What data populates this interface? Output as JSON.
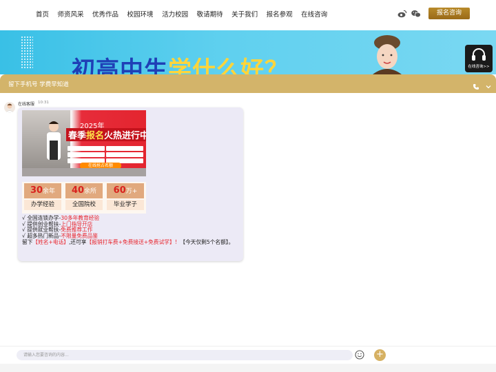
{
  "nav": {
    "items": [
      {
        "label": "首页"
      },
      {
        "label": "师资风采"
      },
      {
        "label": "优秀作品"
      },
      {
        "label": "校园环境"
      },
      {
        "label": "活力校园"
      },
      {
        "label": "敬请期待"
      },
      {
        "label": "关于我们"
      },
      {
        "label": "报名参观"
      },
      {
        "label": "在线咨询"
      }
    ],
    "social_icons": [
      "weibo-icon",
      "wechat-icon"
    ],
    "apply_button": "报名咨询"
  },
  "banner": {
    "headline_part1": "初高中生",
    "headline_part2": "学什么好？",
    "colors": {
      "blue": "#1f3fb6",
      "yellow": "#ffd53a",
      "bg": "#39c0e6"
    }
  },
  "online_widget": {
    "label": "在线咨询>>"
  },
  "chat": {
    "header_text": "留下手机号 学费早知道",
    "header_color": "#d3b46a",
    "agent_name": "在线客服",
    "time": "10:31",
    "promo": {
      "title_line1": "2025年",
      "title_line2_a": "春季",
      "title_line2_b": "报名",
      "title_line2_c": "火热进行中",
      "cta": "在线抢占名额"
    },
    "stats": [
      {
        "number": "30",
        "unit": "余年",
        "label": "办学经验"
      },
      {
        "number": "40",
        "unit": "余所",
        "label": "全国院校"
      },
      {
        "number": "60",
        "unit": "万+",
        "label": "毕业学子"
      }
    ],
    "lines": [
      {
        "prefix": "√ 全国连锁办学-",
        "highlight": "30多年教育经验"
      },
      {
        "prefix": "√ 提供创业帮扶-",
        "highlight": "上门指导开店"
      },
      {
        "prefix": "√ 提供就业帮扶-",
        "highlight": "免费推荐工作"
      },
      {
        "prefix": "√ 超多热门新品-",
        "highlight": "不限量免费品鉴"
      }
    ],
    "closing": {
      "a": "留下",
      "b": "【姓名+电话】",
      "c": ",还可享",
      "d": "【报销打车费+免费接送+免费试学】！",
      "e": "【今天仅剩5个名额】",
      "f": "。"
    }
  },
  "input": {
    "placeholder": "请输入您要咨询的内容..."
  }
}
